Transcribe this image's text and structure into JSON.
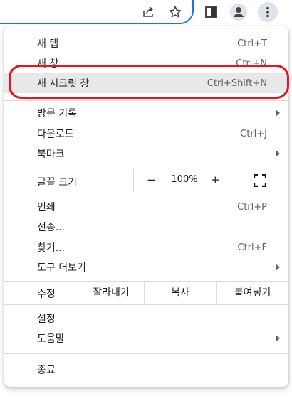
{
  "toolbar": {
    "icons": [
      "share-icon",
      "star-icon",
      "side-panel-icon",
      "profile-icon",
      "more-vert-icon"
    ]
  },
  "menu": {
    "new_tab": {
      "label": "새 탭",
      "shortcut": "Ctrl+T"
    },
    "new_window": {
      "label": "새 창",
      "shortcut": "Ctrl+N"
    },
    "new_incognito": {
      "label": "새 시크릿 창",
      "shortcut": "Ctrl+Shift+N"
    },
    "history": {
      "label": "방문 기록"
    },
    "downloads": {
      "label": "다운로드",
      "shortcut": "Ctrl+J"
    },
    "bookmarks": {
      "label": "북마크"
    },
    "zoom": {
      "label": "글꼴 크기",
      "minus": "−",
      "value": "100%",
      "plus": "+"
    },
    "print": {
      "label": "인쇄",
      "shortcut": "Ctrl+P"
    },
    "cast": {
      "label": "전송..."
    },
    "find": {
      "label": "찾기...",
      "shortcut": "Ctrl+F"
    },
    "more_tools": {
      "label": "도구 더보기"
    },
    "edit": {
      "label": "수정",
      "cut": "잘라내기",
      "copy": "복사",
      "paste": "붙여넣기"
    },
    "settings": {
      "label": "설정"
    },
    "help": {
      "label": "도움말"
    },
    "exit": {
      "label": "종료"
    }
  },
  "colors": {
    "annotation": "#e8141b",
    "highlight": "#e8e8e8",
    "accent": "#1a73e8"
  }
}
